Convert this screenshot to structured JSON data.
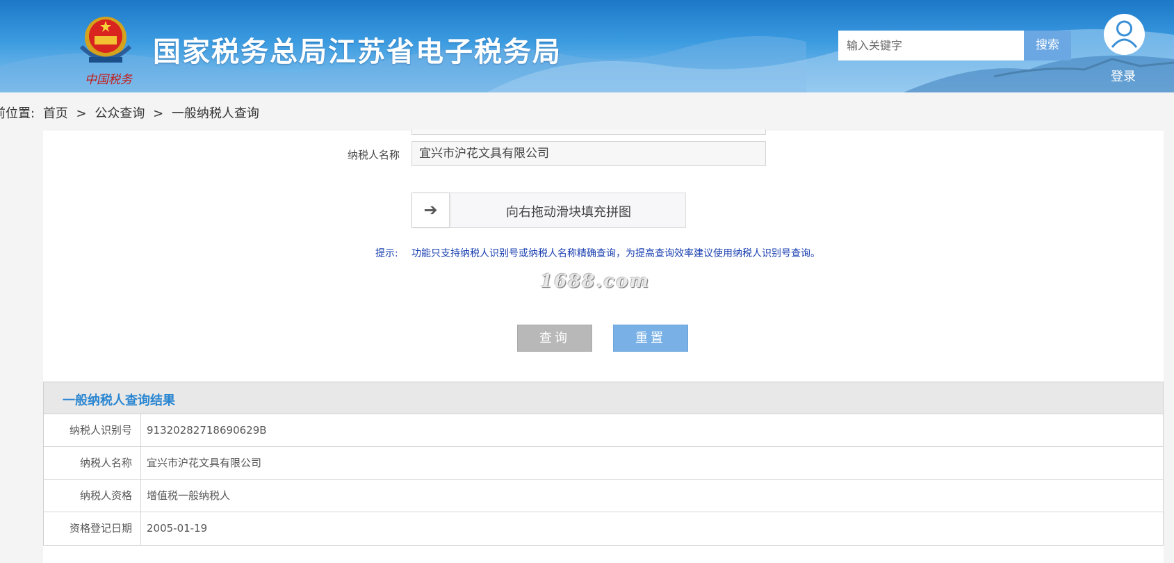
{
  "header": {
    "emblem_caption": "中国税务",
    "site_title": "国家税务总局江苏省电子税务局",
    "search_placeholder": "输入关键字",
    "search_button": "搜索",
    "login": "登录",
    "icons": [
      "national-emblem-icon",
      "user-avatar-icon"
    ]
  },
  "breadcrumb": {
    "label": "前位置:",
    "items": [
      "首页",
      ">",
      "公众查询",
      ">",
      "一般纳税人查询"
    ]
  },
  "form": {
    "name_label": "纳税人名称",
    "name_value": "宜兴市沪花文具有限公司",
    "slider_arrow": "➔",
    "slider_text": "向右拖动滑块填充拼图",
    "tip_label": "提示:",
    "tip_text": "功能只支持纳税人识别号或纳税人名称精确查询，为提高查询效率建议使用纳税人识别号查询。",
    "watermark": "1688.com",
    "query_button": "查询",
    "reset_button": "重置"
  },
  "result": {
    "title": "一般纳税人查询结果",
    "rows": [
      {
        "label": "纳税人识别号",
        "value": "91320282718690629B"
      },
      {
        "label": "纳税人名称",
        "value": "宜兴市沪花文具有限公司"
      },
      {
        "label": "纳税人资格",
        "value": "增值税一般纳税人"
      },
      {
        "label": "资格登记日期",
        "value": "2005-01-19"
      }
    ]
  },
  "colors": {
    "header_blue": "#1c78c8",
    "accent_blue": "#2a86d1",
    "tip_blue": "#1a3fb0",
    "query_gray": "#b8b8b8",
    "reset_blue": "#79b1e6"
  }
}
